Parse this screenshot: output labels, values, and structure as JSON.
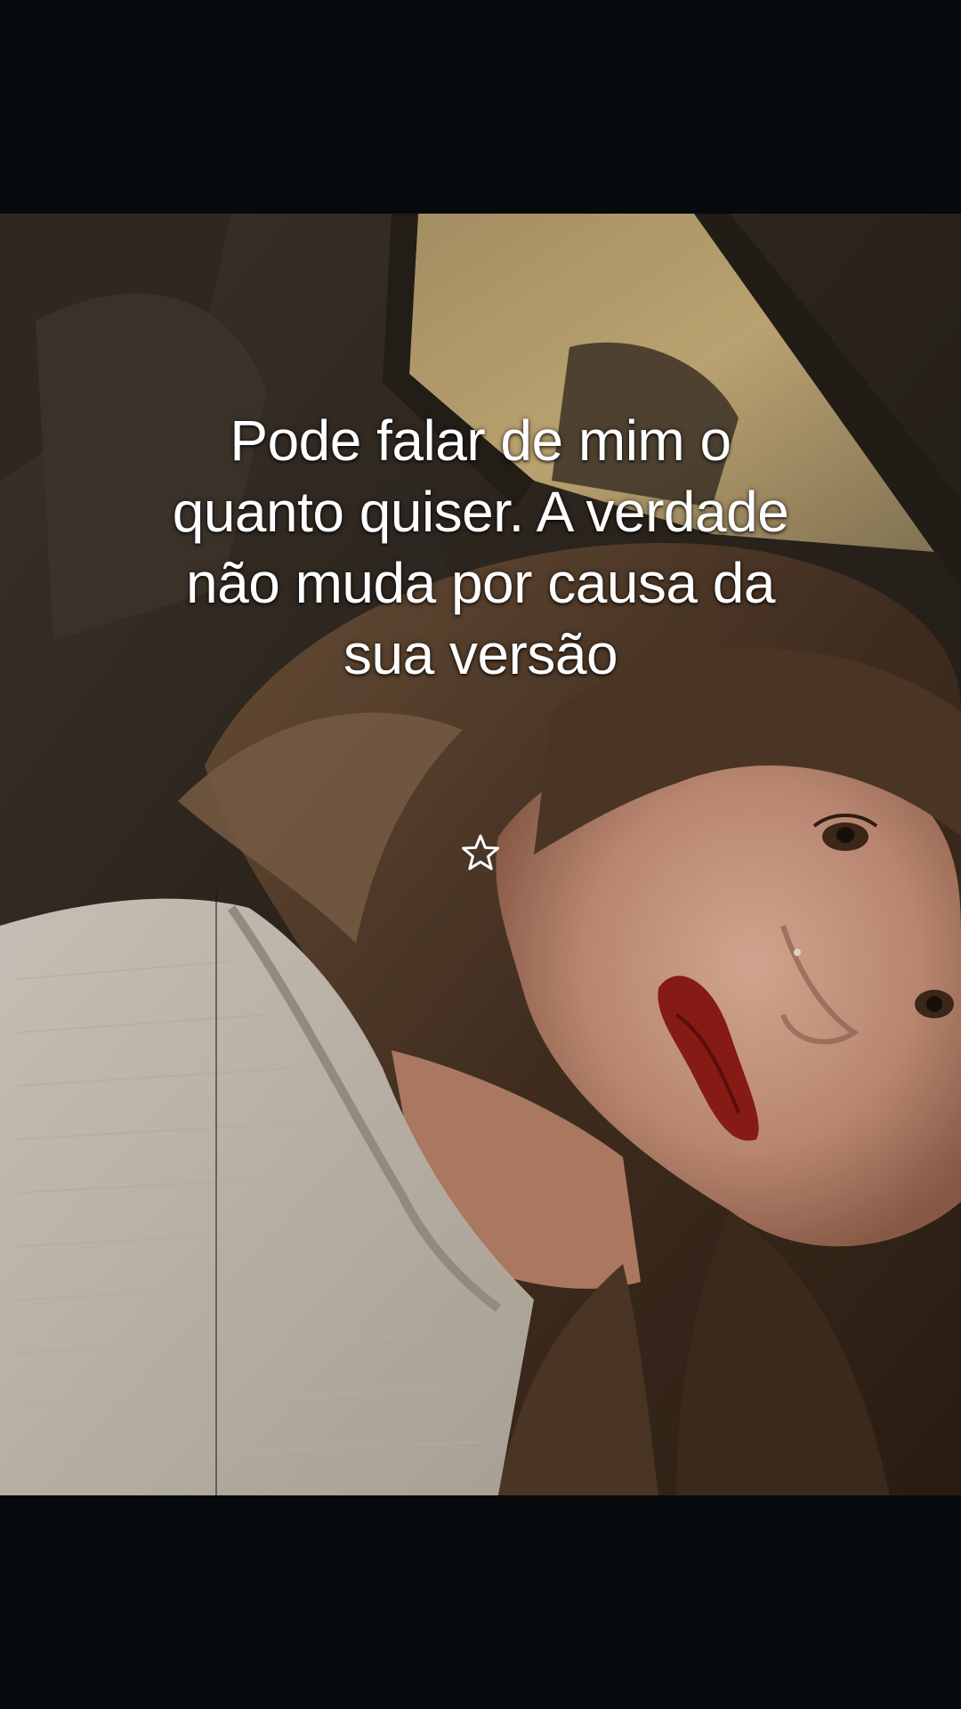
{
  "caption": {
    "text": "Pode falar de mim o\nquanto quiser. A verdade\nnão muda por causa da\nsua versão"
  },
  "sticker": {
    "icon": "star-outline-icon",
    "color": "#ffffff"
  },
  "colors": {
    "letterbox": "#060a0c",
    "caption_text": "#ffffff"
  }
}
